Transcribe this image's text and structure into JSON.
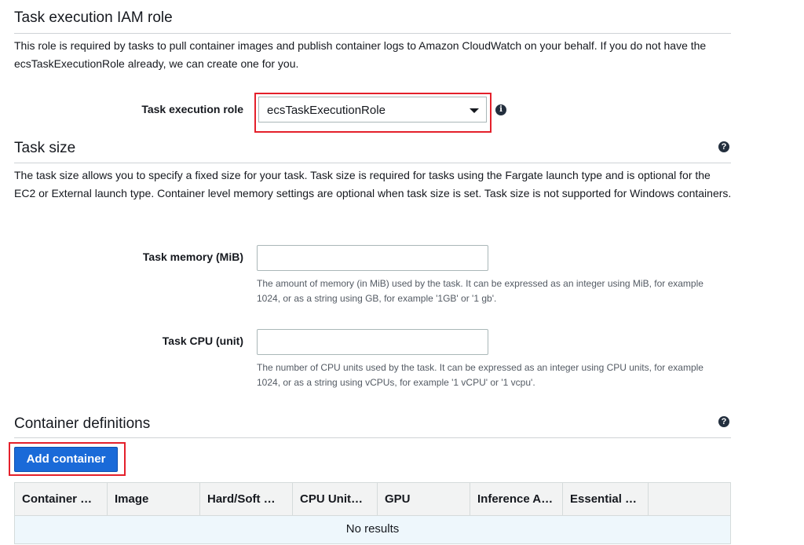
{
  "iam_section": {
    "title": "Task execution IAM role",
    "description": "This role is required by tasks to pull container images and publish container logs to Amazon CloudWatch on your behalf. If you do not have the ecsTaskExecutionRole already, we can create one for you.",
    "role_label": "Task execution role",
    "role_value": "ecsTaskExecutionRole"
  },
  "size_section": {
    "title": "Task size",
    "description": "The task size allows you to specify a fixed size for your task. Task size is required for tasks using the Fargate launch type and is optional for the EC2 or External launch type. Container level memory settings are optional when task size is set. Task size is not supported for Windows containers.",
    "memory_label": "Task memory (MiB)",
    "memory_value": "",
    "memory_hint": "The amount of memory (in MiB) used by the task. It can be expressed as an integer using MiB, for example 1024, or as a string using GB, for example '1GB' or '1 gb'.",
    "cpu_label": "Task CPU (unit)",
    "cpu_value": "",
    "cpu_hint": "The number of CPU units used by the task. It can be expressed as an integer using CPU units, for example 1024, or as a string using vCPUs, for example '1 vCPU' or '1 vcpu'."
  },
  "containers_section": {
    "title": "Container definitions",
    "add_button": "Add container",
    "columns": [
      "Container …",
      "Image",
      "Hard/Soft …",
      "CPU Unit…",
      "GPU",
      "Inference A…",
      "Essential …",
      ""
    ],
    "empty_text": "No results"
  },
  "icons": {
    "help": "question-circle-icon",
    "info": "info-circle-icon",
    "dropdown": "caret-down-icon"
  },
  "colors": {
    "primary_button": "#1a6ad8",
    "highlight": "#e4202b",
    "table_header": "#f2f3f3",
    "empty_row": "#eef7fc"
  }
}
